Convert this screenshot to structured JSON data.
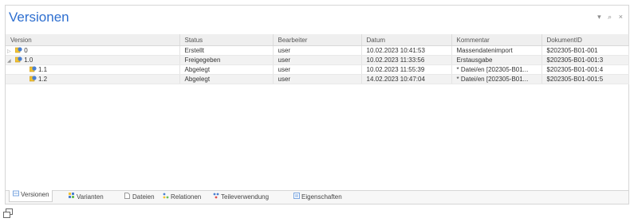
{
  "panel": {
    "title": "Versionen",
    "header_icons": {
      "pin": "▾",
      "dock": "⌕",
      "close": "×"
    }
  },
  "table": {
    "columns": [
      "Version",
      "Status",
      "Bearbeiter",
      "Datum",
      "Kommentar",
      "DokumentID"
    ],
    "rows": [
      {
        "expander": "▷",
        "version": "0",
        "status": "Erstellt",
        "user": "user",
        "date": "10.02.2023 10:41:53",
        "comment": "Massendatenimport",
        "docid": "$202305-B01-001"
      },
      {
        "expander": "◢",
        "version": "1.0",
        "status": "Freigegeben",
        "user": "user",
        "date": "10.02.2023 11:33:56",
        "comment": "Erstausgabe",
        "docid": "$202305-B01-001:3"
      },
      {
        "expander": "",
        "version": "1.1",
        "status": "Abgelegt",
        "user": "user",
        "date": "10.02.2023 11:55:39",
        "comment": "* Datei/en [202305-B01...",
        "docid": "$202305-B01-001:4"
      },
      {
        "expander": "",
        "version": "1.2",
        "status": "Abgelegt",
        "user": "user",
        "date": "14.02.2023 10:47:04",
        "comment": "* Datei/en [202305-B01...",
        "docid": "$202305-B01-001:5"
      }
    ]
  },
  "tabs": [
    {
      "label": "Versionen",
      "icon": "versions-icon"
    },
    {
      "label": "Varianten",
      "icon": "variants-icon"
    },
    {
      "label": "Dateien",
      "icon": "files-icon"
    },
    {
      "label": "Relationen",
      "icon": "relations-icon"
    },
    {
      "label": "Teileverwendung",
      "icon": "part-usage-icon"
    },
    {
      "label": "Eigenschaften",
      "icon": "properties-icon"
    }
  ],
  "colors": {
    "accent": "#2e6fd0",
    "row_shaded": "#f2f2f2",
    "header_bg": "#efefef",
    "icon_yellow": "#f1c232",
    "icon_blue": "#4a7fd0"
  }
}
